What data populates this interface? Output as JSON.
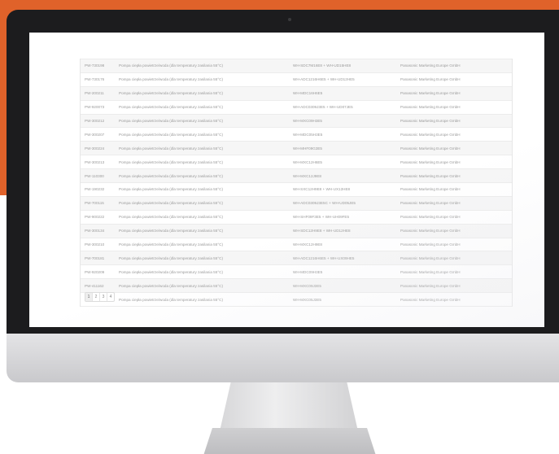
{
  "table": {
    "rows": [
      {
        "id": "PW-730198",
        "type": "Pompa ciepła powietrze/woda (dla temperatury zasilania 55°C)",
        "model": "WH-SDC7M16E8 + WH-UD15HE8",
        "company": "Panasonic Marketing Europe GmbH"
      },
      {
        "id": "PW-730176",
        "type": "Pompa ciepła powietrze/woda (dla temperatury zasilania 55°C)",
        "model": "WH-ADC1216H6E5 + WH-UD12HE5",
        "company": "Panasonic Marketing Europe GmbH"
      },
      {
        "id": "PW-200211",
        "type": "Pompa ciepła powietrze/woda (dla temperatury zasilania 55°C)",
        "model": "WH-MDC16H6E5",
        "company": "Panasonic Marketing Europe GmbH"
      },
      {
        "id": "PW-920073",
        "type": "Pompa ciepła powietrze/woda (dla temperatury zasilania 55°C)",
        "model": "WH-ADC0309J3E5 + WH-UD07JE5",
        "company": "Panasonic Marketing Europe GmbH"
      },
      {
        "id": "PW-300212",
        "type": "Pompa ciepła powietrze/woda (dla temperatury zasilania 55°C)",
        "model": "WH-MXC09H3E5",
        "company": "Panasonic Marketing Europe GmbH"
      },
      {
        "id": "PW-300207",
        "type": "Pompa ciepła powietrze/woda (dla temperatury zasilania 55°C)",
        "model": "WH-MDC05H3E5",
        "company": "Panasonic Marketing Europe GmbH"
      },
      {
        "id": "PW-300224",
        "type": "Pompa ciepła powietrze/woda (dla temperatury zasilania 55°C)",
        "model": "WH-MHF09G3E5",
        "company": "Panasonic Marketing Europe GmbH"
      },
      {
        "id": "PW-300213",
        "type": "Pompa ciepła powietrze/woda (dla temperatury zasilania 55°C)",
        "model": "WH-MXC12H6E5",
        "company": "Panasonic Marketing Europe GmbH"
      },
      {
        "id": "PW-110300",
        "type": "Pompa ciepła powietrze/woda (dla temperatury zasilania 55°C)",
        "model": "WH-MXC12J9E8",
        "company": "Panasonic Marketing Europe GmbH"
      },
      {
        "id": "PW-190232",
        "type": "Pompa ciepła powietrze/woda (dla temperatury zasilania 55°C)",
        "model": "WH-SXC12H9E8 + WH-UX12HE8",
        "company": "Panasonic Marketing Europe GmbH"
      },
      {
        "id": "PW-700115",
        "type": "Pompa ciepła powietrze/woda (dla temperatury zasilania 55°C)",
        "model": "WH-ADC0309J3E5C + WH-UD05JE5",
        "company": "Panasonic Marketing Europe GmbH"
      },
      {
        "id": "PW-900222",
        "type": "Pompa ciepła powietrze/woda (dla temperatury zasilania 55°C)",
        "model": "WH-SHF09F3E5 + WH-UH09FE5",
        "company": "Panasonic Marketing Europe GmbH"
      },
      {
        "id": "PW-300134",
        "type": "Pompa ciepła powietrze/woda (dla temperatury zasilania 55°C)",
        "model": "WH-SDC12H9E8 + WH-UD12HE8",
        "company": "Panasonic Marketing Europe GmbH"
      },
      {
        "id": "PW-300210",
        "type": "Pompa ciepła powietrze/woda (dla temperatury zasilania 55°C)",
        "model": "WH-MXC12H9E8",
        "company": "Panasonic Marketing Europe GmbH"
      },
      {
        "id": "PW-700181",
        "type": "Pompa ciepła powietrze/woda (dla temperatury zasilania 55°C)",
        "model": "WH-ADC1216H6E5 + WH-UX09HE5",
        "company": "Panasonic Marketing Europe GmbH"
      },
      {
        "id": "PW-920209",
        "type": "Pompa ciepła powietrze/woda (dla temperatury zasilania 55°C)",
        "model": "WH-MDC09H3E5",
        "company": "Panasonic Marketing Europe GmbH"
      },
      {
        "id": "PW-411162",
        "type": "Pompa ciepła powietrze/woda (dla temperatury zasilania 55°C)",
        "model": "WH-MXC09J3E5",
        "company": "Panasonic Marketing Europe GmbH"
      },
      {
        "id": "PW-310558",
        "type": "Pompa ciepła powietrze/woda (dla temperatury zasilania 55°C)",
        "model": "WH-MXC05J3E5",
        "company": "Panasonic Marketing Europe GmbH"
      }
    ]
  },
  "pagination": {
    "pages": [
      "1",
      "2",
      "3",
      "4"
    ],
    "active": "1"
  },
  "colors": {
    "accent": "#e0622a",
    "bezel": "#1c1c1e"
  }
}
